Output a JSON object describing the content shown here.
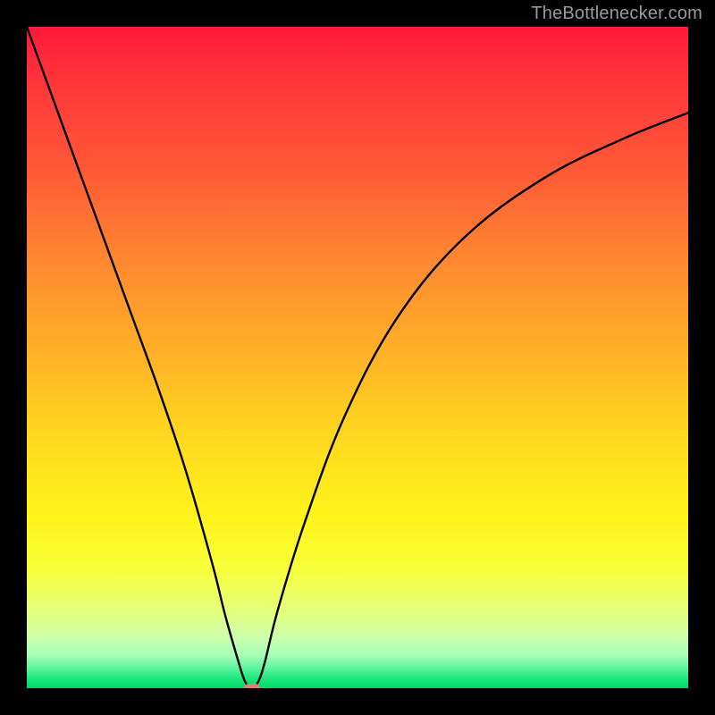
{
  "watermark": {
    "text": "TheBottlenecker.com"
  },
  "chart_data": {
    "type": "line",
    "title": "",
    "xlabel": "",
    "ylabel": "",
    "xlim": [
      0,
      100
    ],
    "ylim": [
      0,
      100
    ],
    "background": {
      "type": "vertical-gradient",
      "stops": [
        {
          "pos": 0,
          "color": "#ff1a3a"
        },
        {
          "pos": 0.5,
          "color": "#ffb326"
        },
        {
          "pos": 0.74,
          "color": "#fff31a"
        },
        {
          "pos": 1.0,
          "color": "#00d968"
        }
      ],
      "meaning": "red high / green low (bottleneck severity)"
    },
    "series": [
      {
        "name": "bottleneck-curve",
        "x": [
          0,
          4,
          8,
          12,
          16,
          20,
          24,
          28,
          30,
          32,
          33,
          34,
          35,
          36,
          38,
          42,
          48,
          56,
          66,
          78,
          90,
          100
        ],
        "y": [
          100,
          89,
          78,
          67,
          56,
          45,
          33,
          19,
          11,
          4,
          1,
          0,
          1,
          4,
          12,
          25,
          41,
          56,
          68,
          77,
          83,
          87
        ],
        "color": "#000000",
        "linewidth": 2.4
      }
    ],
    "marker": {
      "name": "optimal-point",
      "x": 34,
      "y": 0,
      "color": "#e77a7a",
      "shape": "rounded-rect"
    },
    "grid": false,
    "legend": false
  },
  "plot_geometry": {
    "outer_w": 800,
    "outer_h": 800,
    "inner_left": 30,
    "inner_top": 30,
    "inner_w": 740,
    "inner_h": 740
  }
}
